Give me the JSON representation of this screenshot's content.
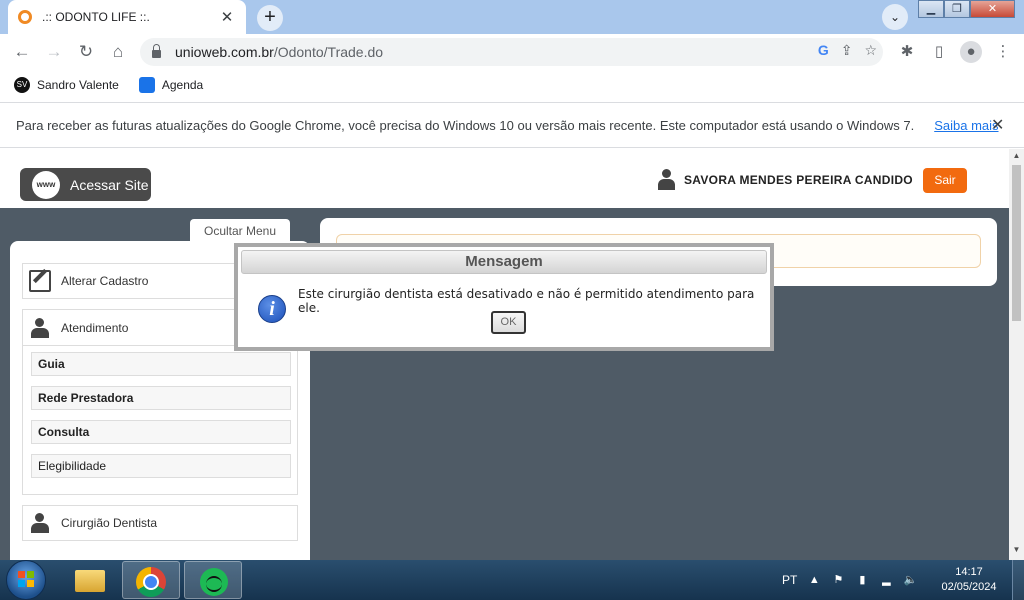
{
  "browser": {
    "tab_title": ".:: ODONTO LIFE ::.",
    "tab_close": "✕",
    "new_tab": "+",
    "url_host": "unioweb.com.br",
    "url_path": "/Odonto/Trade.do",
    "bookmarks": [
      {
        "label": "Sandro Valente",
        "icon_text": "SV"
      },
      {
        "label": "Agenda"
      }
    ],
    "infobar_message": "Para receber as futuras atualizações do Google Chrome, você precisa do Windows 10 ou versão mais recente. Este computador está usando o Windows 7.",
    "infobar_link": "Saiba mais",
    "infobar_close": "✕"
  },
  "header": {
    "site_button": "Acessar Site",
    "www_label": "www",
    "user_name": "SAVORA MENDES PEREIRA CANDIDO",
    "logout": "Sair"
  },
  "sidebar": {
    "toggle": "Ocultar Menu",
    "alterar_cadastro": "Alterar Cadastro",
    "atendimento": "Atendimento",
    "sub_items": [
      "Guia",
      "Rede Prestadora",
      "Consulta",
      "Elegibilidade"
    ],
    "cirurgiao": "Cirurgião Dentista"
  },
  "modal": {
    "title": "Mensagem",
    "icon_text": "i",
    "message": "Este cirurgião dentista está desativado e não é permitido atendimento para ele.",
    "ok": "OK"
  },
  "taskbar": {
    "language": "PT",
    "time": "14:17",
    "date": "02/05/2024"
  }
}
